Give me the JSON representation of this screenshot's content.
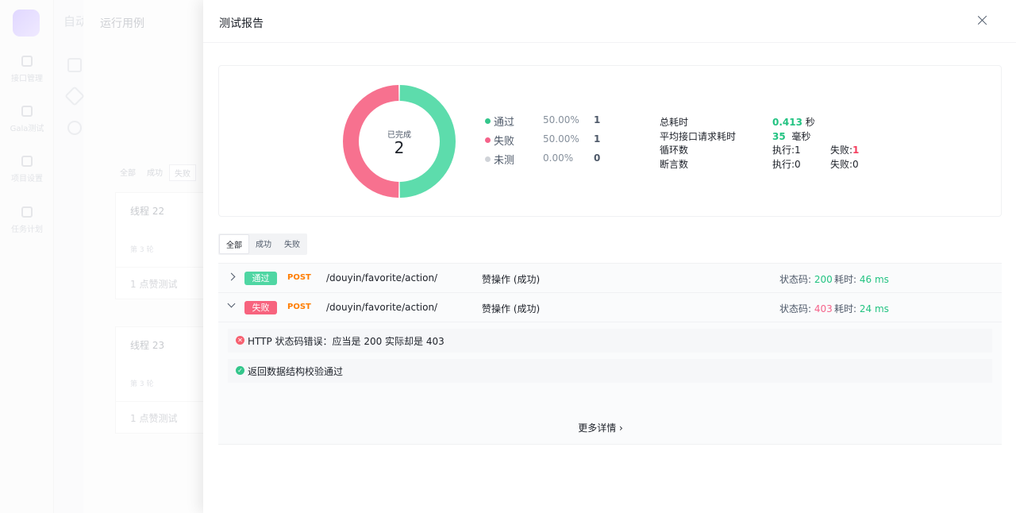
{
  "background": {
    "app_title": "自动",
    "panel_title": "运行用例",
    "nav": [
      "接口管理",
      "Gala测试",
      "项目设置",
      "任务计划"
    ],
    "tabs": [
      "全部",
      "成功",
      "失败"
    ],
    "cards": [
      {
        "title": "线程 22",
        "round": "第 3 轮",
        "case": "1   点赞测试"
      },
      {
        "title": "线程 23",
        "round": "第 3 轮",
        "case": "1   点赞测试"
      }
    ]
  },
  "drawer": {
    "title": "测试报告",
    "donut": {
      "label": "已完成",
      "count": "2",
      "pass_color": "#5ddcac",
      "fail_color": "#f7718f",
      "pass_fraction": 0.5
    },
    "legend": [
      {
        "name": "通过",
        "pct": "50.00%",
        "num": "1",
        "color": "#33c68b"
      },
      {
        "name": "失败",
        "pct": "50.00%",
        "num": "1",
        "color": "#f5638a"
      },
      {
        "name": "未测",
        "pct": "0.00%",
        "num": "0",
        "color": "#d0d3d8"
      }
    ],
    "stats": {
      "total_time_label": "总耗时",
      "total_time_value": "0.413",
      "total_time_unit": "秒",
      "avg_time_label": "平均接口请求耗时",
      "avg_time_value": "35",
      "avg_time_unit": "毫秒",
      "loop_label": "循环数",
      "loop_exec": "执行:1",
      "loop_fail_label": "失败:",
      "loop_fail_value": "1",
      "assert_label": "断言数",
      "assert_exec": "执行:0",
      "assert_fail": "失败:0"
    },
    "filter_tabs": [
      "全部",
      "成功",
      "失败"
    ],
    "results": [
      {
        "status": "通过",
        "method": "POST",
        "path": "/douyin/favorite/action/",
        "desc": "赞操作 (成功)",
        "code_label": "状态码: ",
        "code": "200",
        "cost_label": "耗时: ",
        "cost": "46 ms"
      },
      {
        "status": "失败",
        "method": "POST",
        "path": "/douyin/favorite/action/",
        "desc": "赞操作 (成功)",
        "code_label": "状态码: ",
        "code": "403",
        "cost_label": "耗时: ",
        "cost": "24 ms"
      }
    ],
    "assertions": [
      {
        "type": "error",
        "text": "HTTP 状态码错误：应当是 200 实际却是 403"
      },
      {
        "type": "ok",
        "text": "返回数据结构校验通过"
      }
    ],
    "more_label": "更多详情 ›"
  }
}
